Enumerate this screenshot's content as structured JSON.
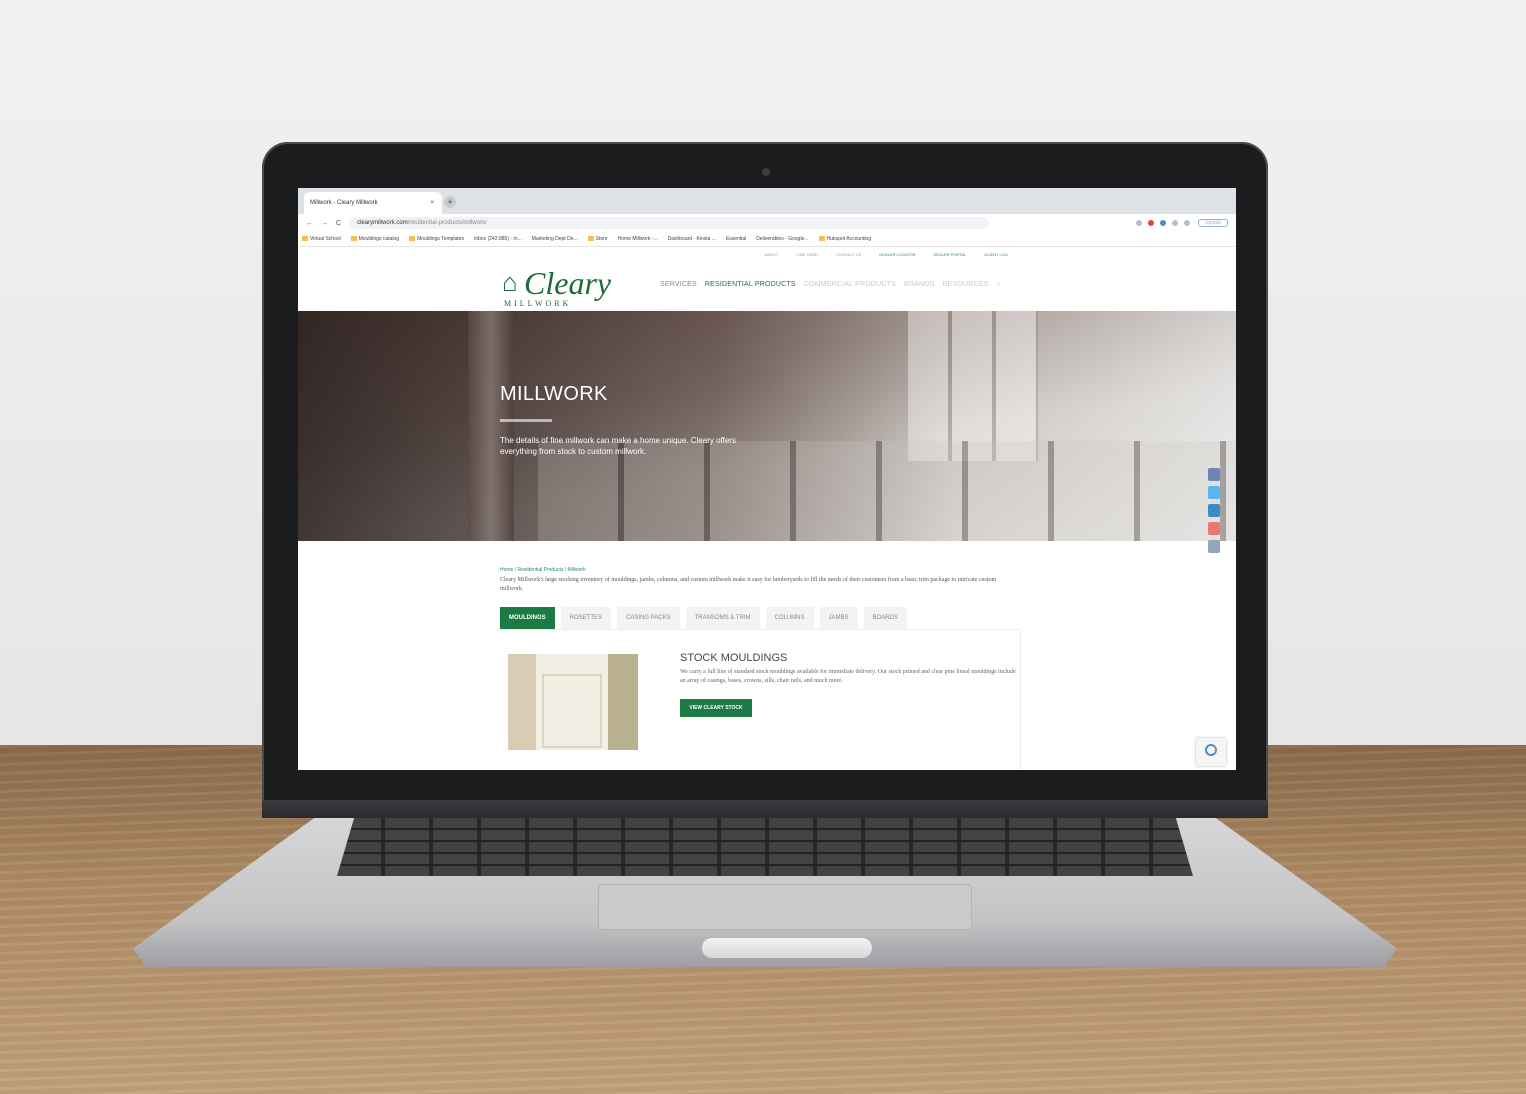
{
  "browser": {
    "tab_title": "Millwork - Cleary Millwork",
    "tab_close": "×",
    "new_tab": "+",
    "back": "←",
    "forward": "→",
    "reload": "C",
    "url_host": "clearymillwork.com",
    "url_path": "/residential-products/millwork/",
    "update_label": "Update"
  },
  "bookmarks": [
    "Virtual School",
    "Mouldings catalog",
    "Mouldings Templates",
    "Inbox (242,885) - m...",
    "Marketing Dept Do...",
    "Store",
    "Home Millwork -...",
    "Dashboard · Kinsta ...",
    "Essential",
    "Deliverables · Google...",
    "Hubspot Accounting"
  ],
  "site": {
    "utility": [
      "ABOUT",
      "LINE CARD",
      "CONTACT US",
      "DEALER LOCATOR",
      "DEALER PORTAL",
      "CLIENT LOG"
    ],
    "logo_name": "Cleary",
    "logo_sub": "MILLWORK",
    "nav": [
      "SERVICES",
      "RESIDENTIAL PRODUCTS",
      "COMMERCIAL PRODUCTS",
      "BRANDS",
      "RESOURCES"
    ],
    "hero_title": "MILLWORK",
    "hero_text": "The details of fine millwork can make a home unique. Cleary offers everything from stock to custom millwork.",
    "breadcrumb": "Home / Residential Products / Millwork",
    "intro": "Cleary Millwork's large stocking inventory of mouldings, jambs, columns, and custom millwork make it easy for lumberyards to fill the needs of their customers from a basic trim package to intricate custom millwork.",
    "tabs": [
      "MOULDINGS",
      "ROSETTES",
      "CASING PACKS",
      "TRANSOMS & TRIM",
      "COLUMNS",
      "JAMBS",
      "BOARDS"
    ],
    "section_title": "STOCK MOULDINGS",
    "section_text": "We carry a full line of standard stock mouldings available for immediate delivery. Our stock primed and clear pine lineal mouldings include an array of casings, bases, crowns, sills, chair rails, and much more.",
    "section_button": "VIEW CLEARY STOCK",
    "social_colors": [
      "#3b5998",
      "#1da1f2",
      "#0077b5",
      "#e0443b",
      "#7a8fa8"
    ]
  }
}
